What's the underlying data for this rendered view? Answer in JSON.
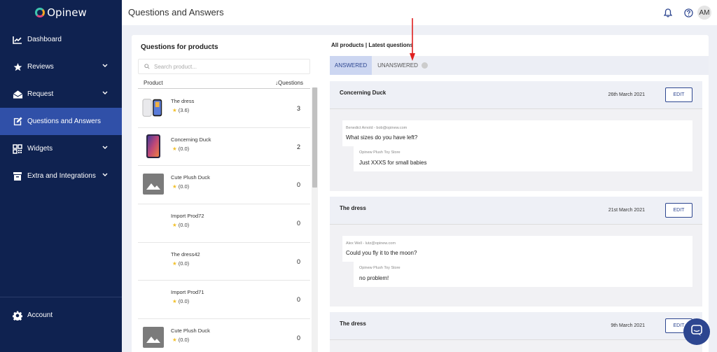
{
  "sidebar": {
    "logo_text": "Opinew",
    "items": [
      {
        "label": "Dashboard",
        "icon": "chart-line-icon"
      },
      {
        "label": "Reviews",
        "icon": "star-icon"
      },
      {
        "label": "Request",
        "icon": "envelope-open-icon"
      },
      {
        "label": "Questions and Answers",
        "icon": "edit-icon"
      },
      {
        "label": "Widgets",
        "icon": "qr-icon"
      },
      {
        "label": "Extra and Integrations",
        "icon": "archive-icon"
      }
    ],
    "account_label": "Account"
  },
  "header": {
    "title": "Questions and Answers",
    "avatar_initials": "AM"
  },
  "products_panel": {
    "title": "Questions for products",
    "search_placeholder": "Search product...",
    "col_product": "Product",
    "col_questions": "Questions",
    "rows": [
      {
        "name": "The dress",
        "rating": "(3.6)",
        "count": "3",
        "thumb": "phones"
      },
      {
        "name": "Concerning Duck",
        "rating": "(0.0)",
        "count": "2",
        "thumb": "phone"
      },
      {
        "name": "Cute Plush Duck",
        "rating": "(0.0)",
        "count": "0",
        "thumb": "placeholder"
      },
      {
        "name": "Import Prod72",
        "rating": "(0.0)",
        "count": "0",
        "thumb": "none"
      },
      {
        "name": "The dress42",
        "rating": "(0.0)",
        "count": "0",
        "thumb": "none"
      },
      {
        "name": "Import Prod71",
        "rating": "(0.0)",
        "count": "0",
        "thumb": "none"
      },
      {
        "name": "Cute Plush Duck",
        "rating": "(0.0)",
        "count": "0",
        "thumb": "placeholder"
      }
    ]
  },
  "questions_panel": {
    "heading": "All products | Latest questions",
    "tabs": {
      "answered": "ANSWERED",
      "unanswered": "UNANSWERED"
    },
    "edit_label": "EDIT",
    "questions": [
      {
        "product": "Concerning Duck",
        "date": "26th March 2021",
        "author": "Benedict Arnold - bob@opinew.com",
        "question": "What sizes do you have left?",
        "reply_author": "Opinew Plush Toy Store",
        "reply": "Just XXXS for small babies"
      },
      {
        "product": "The dress",
        "date": "21st March 2021",
        "author": "Alex Well - lutz@opinew.com",
        "question": "Could you fly it to the moon?",
        "reply_author": "Opinew Plush Toy Store",
        "reply": "no problem!"
      },
      {
        "product": "The dress",
        "date": "9th March 2021"
      }
    ]
  },
  "colors": {
    "sidebar": "#0f2250",
    "active": "#3050a8",
    "accent": "#2d4690",
    "arrow": "#e02020"
  }
}
